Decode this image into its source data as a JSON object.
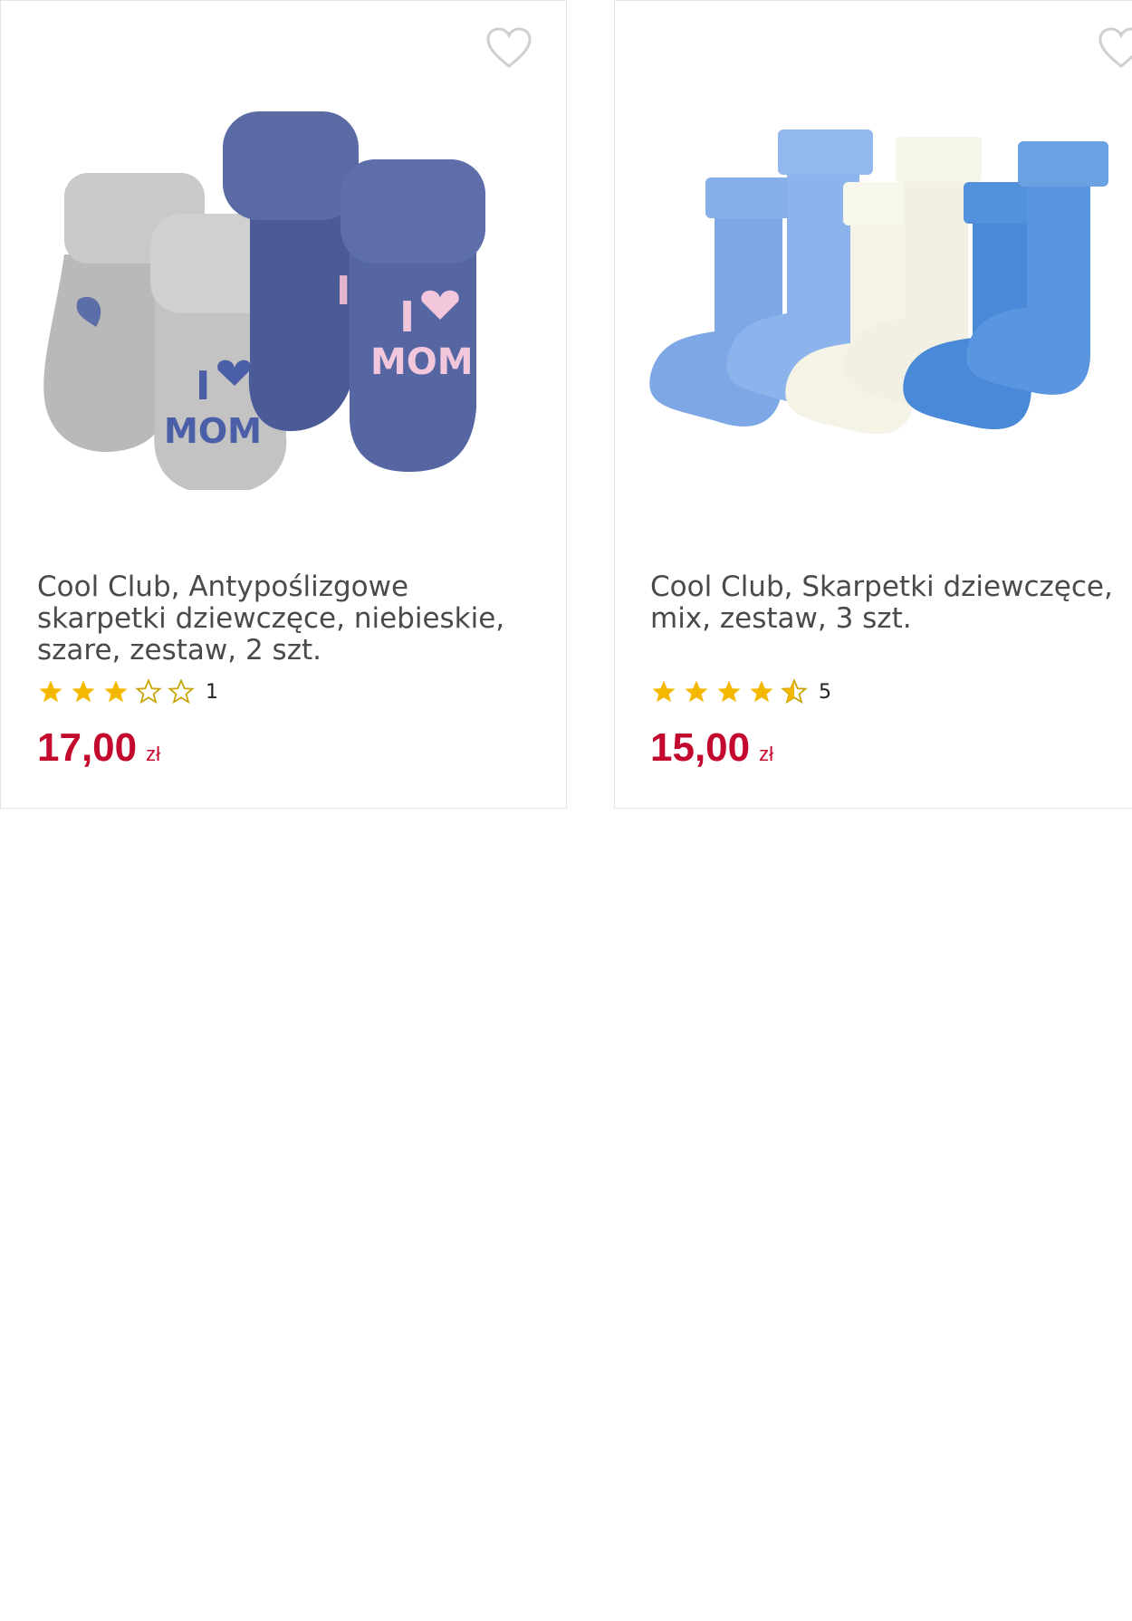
{
  "products": [
    {
      "title": "Cool Club, Antypoślizgowe skarpetki dziewczęce, niebieskie, szare, zestaw, 2 szt.",
      "rating": 3,
      "review_count": "1",
      "price": "17,00",
      "currency": "zł",
      "image_texts": [
        "I",
        "MOM",
        "I",
        "MOM"
      ],
      "favorite_icon": "heart-outline-icon"
    },
    {
      "title": "Cool Club, Skarpetki dziewczęce, mix, zestaw, 3 szt.",
      "rating": 4.5,
      "review_count": "5",
      "price": "15,00",
      "currency": "zł",
      "favorite_icon": "heart-outline-icon"
    }
  ],
  "colors": {
    "price": "#c3092d",
    "star": "#f5b800",
    "star_empty": "#c9a400",
    "border": "#e3e3e3"
  }
}
